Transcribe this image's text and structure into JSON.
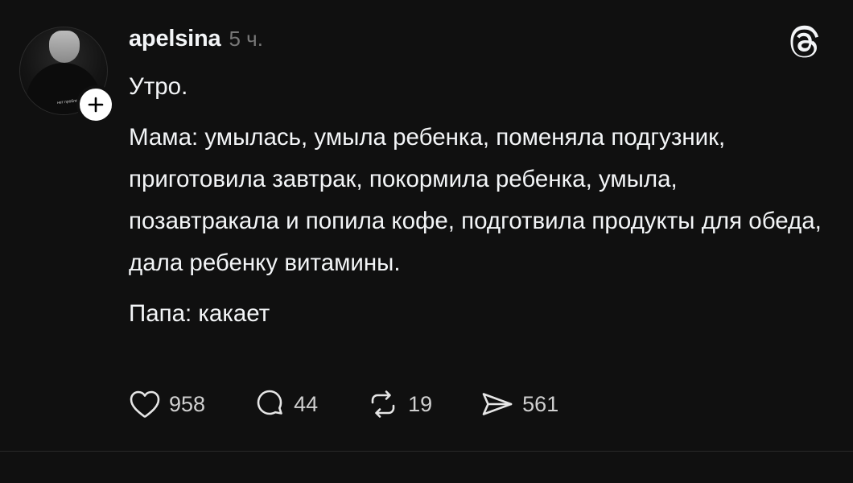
{
  "post": {
    "username": "apelsina",
    "time": "5 ч.",
    "avatar_shirt_text": "нет проблем\nесть задачи",
    "paragraphs": [
      "Утро.",
      "Мама: умылась, умыла ребенка, поменяла подгузник, приготовила завтрак, покормила ребенка, умыла, позавтракала и попила кофе, подготвила продукты для обеда, дала ребенку витамины.",
      "Папа: какает"
    ],
    "actions": {
      "likes": "958",
      "replies": "44",
      "reposts": "19",
      "shares": "561"
    }
  },
  "icons": {
    "follow": "plus-icon",
    "app": "threads-logo-icon",
    "like": "heart-icon",
    "reply": "comment-icon",
    "repost": "repost-icon",
    "share": "send-icon"
  },
  "colors": {
    "background": "#101010",
    "text": "#f3f5f7",
    "muted": "#777777"
  }
}
